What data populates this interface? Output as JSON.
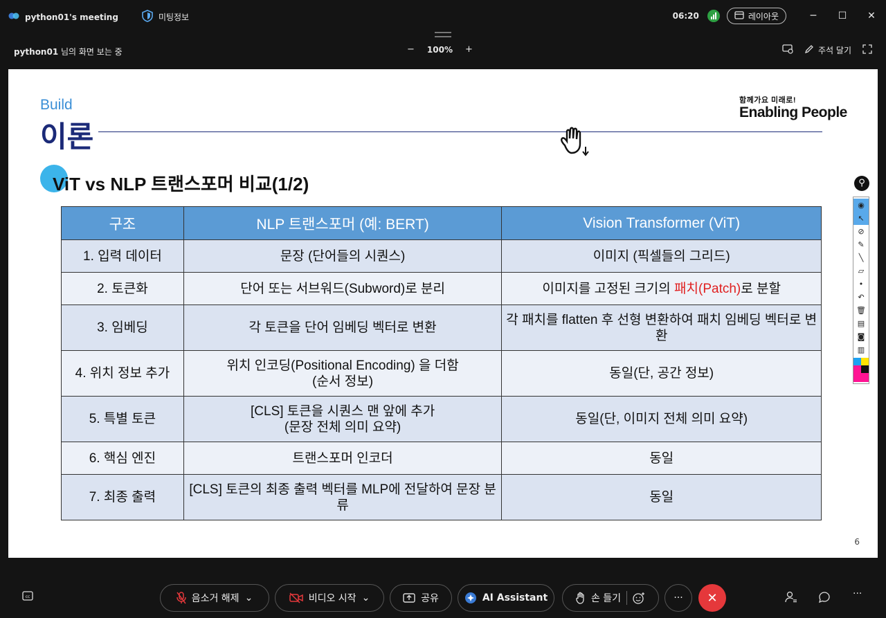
{
  "titlebar": {
    "meeting_title": "python01's meeting",
    "info_label": "미팅정보",
    "time": "06:20",
    "layout_label": "레이아웃"
  },
  "viewbar": {
    "sharer": "python01",
    "viewing_suffix": " 님의 화면 보는 중",
    "zoom": "100%",
    "annotate_label": "주석 달기"
  },
  "slide": {
    "build": "Build",
    "section": "이론",
    "brand_small": "함께가요 미래로!",
    "brand_main": "Enabling People",
    "heading": "ViT vs NLP 트랜스포머 비교(1/2)",
    "page_number": "6",
    "table": {
      "headers": [
        "구조",
        "NLP 트랜스포머 (예: BERT)",
        "Vision Transformer (ViT)"
      ],
      "rows": [
        {
          "c1": "1. 입력 데이터",
          "c2": "문장 (단어들의 시퀀스)",
          "c3": "이미지 (픽셀들의 그리드)"
        },
        {
          "c1": "2. 토큰화",
          "c2": "단어 또는 서브워드(Subword)로 분리",
          "c3a": "이미지를 고정된 크기의 ",
          "c3b": "패치(Patch)",
          "c3c": "로 분할"
        },
        {
          "c1": "3. 임베딩",
          "c2": "각 토큰을 단어 임베딩 벡터로 변환",
          "c3": "각 패치를 flatten 후 선형 변환하여 패치 임베딩 벡터로 변환"
        },
        {
          "c1": "4. 위치 정보 추가",
          "c2a": "위치 인코딩(Positional Encoding) 을 더함",
          "c2b": "(순서 정보)",
          "c3": "동일(단, 공간 정보)"
        },
        {
          "c1": "5. 특별 토큰",
          "c2a": "[CLS] 토큰을 시퀀스 맨 앞에 추가",
          "c2b": "(문장 전체 의미 요약)",
          "c3": "동일(단, 이미지 전체 의미 요약)"
        },
        {
          "c1": "6. 핵심 엔진",
          "c2": "트랜스포머 인코더",
          "c3": "동일"
        },
        {
          "c1": "7. 최종 출력",
          "c2": "[CLS] 토큰의 최종 출력 벡터를 MLP에 전달하여 문장 분류",
          "c3": "동일"
        }
      ]
    }
  },
  "controls": {
    "mute_label": "음소거 해제",
    "video_label": "비디오 시작",
    "share_label": "공유",
    "ai_label": "AI Assistant",
    "raise_hand_label": "손 들기",
    "more_label": "···"
  },
  "colors": {
    "accent_blue": "#3b8fd6",
    "navy": "#1b2a78",
    "header_blue": "#5b9bd5",
    "end_red": "#e5383b",
    "highlight_red": "#e02020"
  }
}
